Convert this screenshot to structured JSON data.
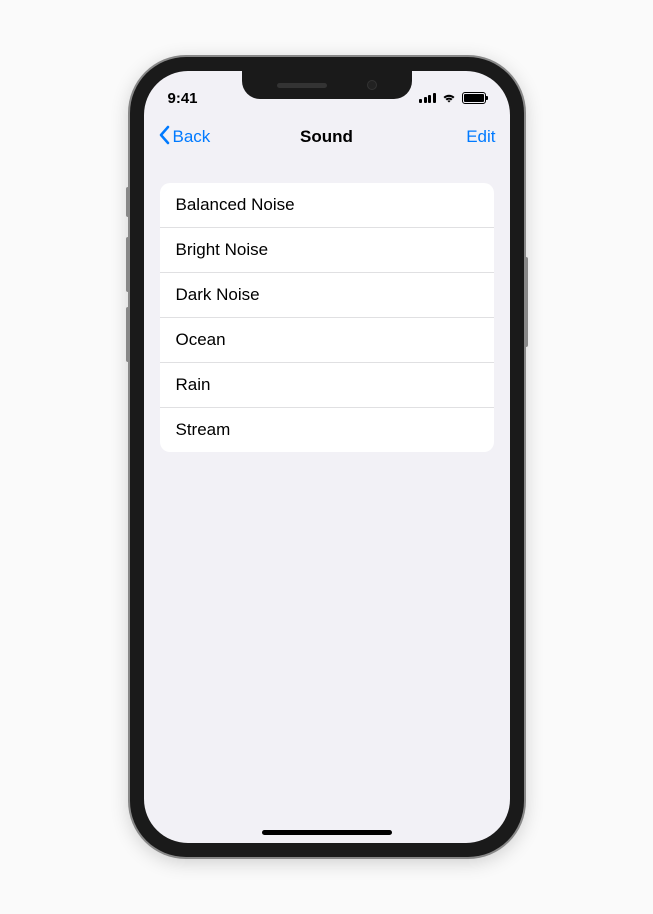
{
  "statusBar": {
    "time": "9:41"
  },
  "navBar": {
    "backLabel": "Back",
    "title": "Sound",
    "editLabel": "Edit"
  },
  "sounds": [
    {
      "label": "Balanced Noise"
    },
    {
      "label": "Bright Noise"
    },
    {
      "label": "Dark Noise"
    },
    {
      "label": "Ocean"
    },
    {
      "label": "Rain"
    },
    {
      "label": "Stream"
    }
  ]
}
